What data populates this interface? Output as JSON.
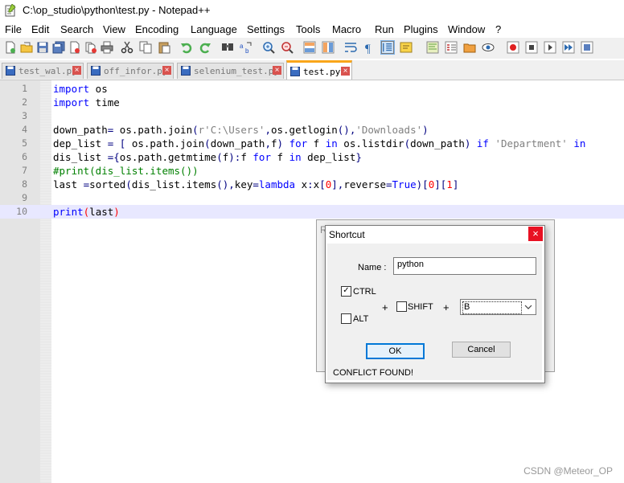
{
  "window": {
    "title": "C:\\op_studio\\python\\test.py - Notepad++"
  },
  "menu": [
    "File",
    "Edit",
    "Search",
    "View",
    "Encoding",
    "Language",
    "Settings",
    "Tools",
    "Macro",
    "Run",
    "Plugins",
    "Window",
    "?"
  ],
  "toolbar_icons": [
    "new-file-icon",
    "open-file-icon",
    "save-icon",
    "save-all-icon",
    "close-icon",
    "close-all-icon",
    "print-icon",
    "cut-icon",
    "copy-icon",
    "paste-icon",
    "undo-icon",
    "redo-icon",
    "find-icon",
    "replace-icon",
    "zoom-in-icon",
    "zoom-out-icon",
    "sync-vertical-icon",
    "sync-horizontal-icon",
    "word-wrap-icon",
    "show-all-chars-icon",
    "indent-guide-icon",
    "language-define-icon",
    "doc-map-icon",
    "function-list-icon",
    "folder-as-workspace-icon",
    "monitoring-icon",
    "record-macro-icon",
    "stop-record-icon",
    "play-macro-icon",
    "run-macro-multiple-icon",
    "save-macro-icon"
  ],
  "tabs": [
    {
      "label": "test_wal.py",
      "active": false
    },
    {
      "label": "off_infor.py",
      "active": false
    },
    {
      "label": "selenium_test.py",
      "active": false
    },
    {
      "label": "test.py",
      "active": true
    }
  ],
  "editor": {
    "line_numbers": [
      "1",
      "2",
      "3",
      "4",
      "5",
      "6",
      "7",
      "8",
      "9",
      "10"
    ],
    "lines": [
      "import os",
      "import time",
      "",
      "down_path= os.path.join(r'C:\\Users',os.getlogin(),'Downloads')",
      "dep_list = [ os.path.join(down_path,f) for f in os.listdir(down_path) if 'Department' in",
      "dis_list ={os.path.getmtime(f):f for f in dep_list}",
      "#print(dis_list.items())",
      "last =sorted(dis_list.items(),key=lambda x:x[0],reverse=True)[0][1]",
      "",
      "print(last)"
    ],
    "current_line": 10
  },
  "background_dialog": {
    "title_fragment": "R"
  },
  "dialog": {
    "title": "Shortcut",
    "close": "×",
    "name_label": "Name :",
    "name_value": "python",
    "ctrl_label": "CTRL",
    "ctrl_checked": true,
    "alt_label": "ALT",
    "alt_checked": false,
    "shift_label": "SHIFT",
    "shift_checked": false,
    "plus1": "+",
    "plus2": "+",
    "key_value": "B",
    "ok_label": "OK",
    "cancel_label": "Cancel",
    "status": "CONFLICT FOUND!"
  },
  "watermark": "CSDN @Meteor_OP"
}
